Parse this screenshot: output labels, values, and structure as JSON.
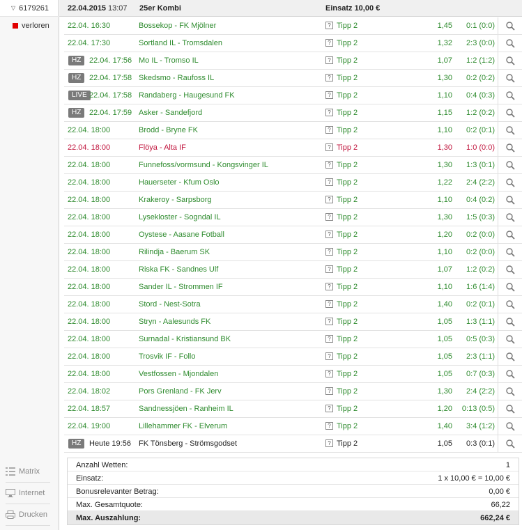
{
  "ticket": {
    "id": "6179261",
    "status": "verloren"
  },
  "header": {
    "date": "22.04.2015",
    "time": "13:07",
    "type": "25er Kombi",
    "stake": "Einsatz 10,00 €"
  },
  "colors": {
    "won": "#2e8b2e",
    "lost": "#c0143c",
    "status_lost": "#e10000"
  },
  "bets": [
    {
      "badge": "",
      "time": "22.04. 16:30",
      "match": "Bossekop - FK Mjölner",
      "tip": "Tipp 2",
      "quota": "1,45",
      "result": "0:1 (0:0)",
      "state": "won"
    },
    {
      "badge": "",
      "time": "22.04. 17:30",
      "match": "Sortland IL - Tromsdalen",
      "tip": "Tipp 2",
      "quota": "1,32",
      "result": "2:3 (0:0)",
      "state": "won"
    },
    {
      "badge": "HZ",
      "time": "22.04. 17:56",
      "match": "Mo IL - Tromso IL",
      "tip": "Tipp 2",
      "quota": "1,07",
      "result": "1:2 (1:2)",
      "state": "won"
    },
    {
      "badge": "HZ",
      "time": "22.04. 17:58",
      "match": "Skedsmo - Raufoss IL",
      "tip": "Tipp 2",
      "quota": "1,30",
      "result": "0:2 (0:2)",
      "state": "won"
    },
    {
      "badge": "LIVE",
      "time": "22.04. 17:58",
      "match": "Randaberg - Haugesund FK",
      "tip": "Tipp 2",
      "quota": "1,10",
      "result": "0:4 (0:3)",
      "state": "won"
    },
    {
      "badge": "HZ",
      "time": "22.04. 17:59",
      "match": "Asker - Sandefjord",
      "tip": "Tipp 2",
      "quota": "1,15",
      "result": "1:2 (0:2)",
      "state": "won"
    },
    {
      "badge": "",
      "time": "22.04. 18:00",
      "match": "Brodd - Bryne FK",
      "tip": "Tipp 2",
      "quota": "1,10",
      "result": "0:2 (0:1)",
      "state": "won"
    },
    {
      "badge": "",
      "time": "22.04. 18:00",
      "match": "Flöya - Alta IF",
      "tip": "Tipp 2",
      "quota": "1,30",
      "result": "1:0 (0:0)",
      "state": "lost"
    },
    {
      "badge": "",
      "time": "22.04. 18:00",
      "match": "Funnefoss/vormsund - Kongsvinger IL",
      "tip": "Tipp 2",
      "quota": "1,30",
      "result": "1:3 (0:1)",
      "state": "won"
    },
    {
      "badge": "",
      "time": "22.04. 18:00",
      "match": "Hauerseter - Kfum Oslo",
      "tip": "Tipp 2",
      "quota": "1,22",
      "result": "2:4 (2:2)",
      "state": "won"
    },
    {
      "badge": "",
      "time": "22.04. 18:00",
      "match": "Krakeroy - Sarpsborg",
      "tip": "Tipp 2",
      "quota": "1,10",
      "result": "0:4 (0:2)",
      "state": "won"
    },
    {
      "badge": "",
      "time": "22.04. 18:00",
      "match": "Lysekloster - Sogndal IL",
      "tip": "Tipp 2",
      "quota": "1,30",
      "result": "1:5 (0:3)",
      "state": "won"
    },
    {
      "badge": "",
      "time": "22.04. 18:00",
      "match": "Oystese - Aasane Fotball",
      "tip": "Tipp 2",
      "quota": "1,20",
      "result": "0:2 (0:0)",
      "state": "won"
    },
    {
      "badge": "",
      "time": "22.04. 18:00",
      "match": "Rilindja - Baerum SK",
      "tip": "Tipp 2",
      "quota": "1,10",
      "result": "0:2 (0:0)",
      "state": "won"
    },
    {
      "badge": "",
      "time": "22.04. 18:00",
      "match": "Riska FK - Sandnes Ulf",
      "tip": "Tipp 2",
      "quota": "1,07",
      "result": "1:2 (0:2)",
      "state": "won"
    },
    {
      "badge": "",
      "time": "22.04. 18:00",
      "match": "Sander IL - Strommen IF",
      "tip": "Tipp 2",
      "quota": "1,10",
      "result": "1:6 (1:4)",
      "state": "won"
    },
    {
      "badge": "",
      "time": "22.04. 18:00",
      "match": "Stord - Nest-Sotra",
      "tip": "Tipp 2",
      "quota": "1,40",
      "result": "0:2 (0:1)",
      "state": "won"
    },
    {
      "badge": "",
      "time": "22.04. 18:00",
      "match": "Stryn - Aalesunds FK",
      "tip": "Tipp 2",
      "quota": "1,05",
      "result": "1:3 (1:1)",
      "state": "won"
    },
    {
      "badge": "",
      "time": "22.04. 18:00",
      "match": "Surnadal - Kristiansund BK",
      "tip": "Tipp 2",
      "quota": "1,05",
      "result": "0:5 (0:3)",
      "state": "won"
    },
    {
      "badge": "",
      "time": "22.04. 18:00",
      "match": "Trosvik IF - Follo",
      "tip": "Tipp 2",
      "quota": "1,05",
      "result": "2:3 (1:1)",
      "state": "won"
    },
    {
      "badge": "",
      "time": "22.04. 18:00",
      "match": "Vestfossen - Mjondalen",
      "tip": "Tipp 2",
      "quota": "1,05",
      "result": "0:7 (0:3)",
      "state": "won"
    },
    {
      "badge": "",
      "time": "22.04. 18:02",
      "match": "Pors Grenland - FK Jerv",
      "tip": "Tipp 2",
      "quota": "1,30",
      "result": "2:4 (2:2)",
      "state": "won"
    },
    {
      "badge": "",
      "time": "22.04. 18:57",
      "match": "Sandnessjöen - Ranheim IL",
      "tip": "Tipp 2",
      "quota": "1,20",
      "result": "0:13 (0:5)",
      "state": "won"
    },
    {
      "badge": "",
      "time": "22.04. 19:00",
      "match": "Lillehammer FK - Elverum",
      "tip": "Tipp 2",
      "quota": "1,40",
      "result": "3:4 (1:2)",
      "state": "won"
    },
    {
      "badge": "HZ",
      "time": "Heute 19:56",
      "match": "FK Tönsberg - Strömsgodset",
      "tip": "Tipp 2",
      "quota": "1,05",
      "result": "0:3 (0:1)",
      "state": "neutral"
    }
  ],
  "summary": [
    {
      "label": "Anzahl Wetten:",
      "value": "1"
    },
    {
      "label": "Einsatz:",
      "value": "1 x 10,00 € = 10,00 €"
    },
    {
      "label": "Bonusrelevanter Betrag:",
      "value": "0,00 €"
    },
    {
      "label": "Max. Gesamtquote:",
      "value": "66,22"
    },
    {
      "label": "Max. Auszahlung:",
      "value": "662,24 €"
    }
  ],
  "actions": [
    {
      "label": "Matrix",
      "icon": "matrix-icon"
    },
    {
      "label": "Internet",
      "icon": "monitor-icon"
    },
    {
      "label": "Drucken",
      "icon": "printer-icon"
    }
  ]
}
